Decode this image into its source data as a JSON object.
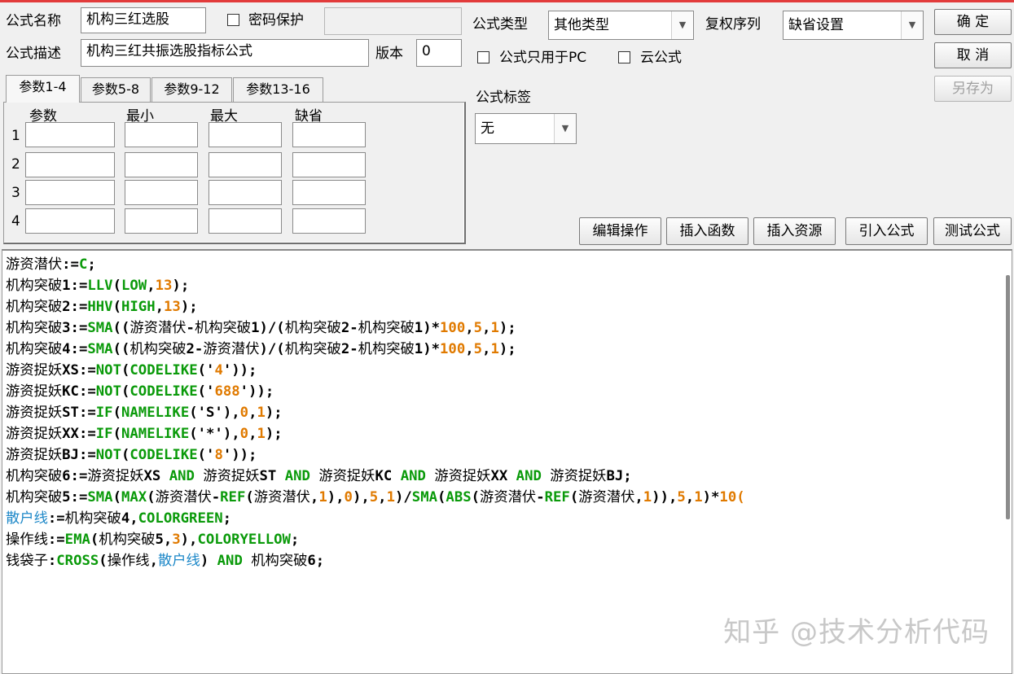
{
  "form": {
    "name_label": "公式名称",
    "name_value": "机构三红选股",
    "password_label": "密码保护",
    "password_value": "",
    "desc_label": "公式描述",
    "desc_value": "机构三红共振选股指标公式",
    "version_label": "版本",
    "version_value": "0",
    "type_label": "公式类型",
    "type_value": "其他类型",
    "rights_label": "复权序列",
    "rights_value": "缺省设置",
    "pc_only_label": "公式只用于PC",
    "cloud_label": "云公式",
    "tag_label": "公式标签",
    "tag_value": "无"
  },
  "buttons": {
    "ok": "确  定",
    "cancel": "取  消",
    "save_as": "另存为",
    "edit_ops": "编辑操作",
    "insert_func": "插入函数",
    "insert_res": "插入资源",
    "import_formula": "引入公式",
    "test_formula": "测试公式"
  },
  "tabs": [
    "参数1-4",
    "参数5-8",
    "参数9-12",
    "参数13-16"
  ],
  "params": {
    "headers": [
      "参数",
      "最小",
      "最大",
      "缺省"
    ],
    "rows": [
      "1",
      "2",
      "3",
      "4"
    ]
  },
  "code_lines": [
    [
      [
        "plain",
        "游资潜伏"
      ],
      [
        "op",
        ":="
      ],
      [
        "fn",
        "C"
      ],
      [
        "op",
        ";"
      ]
    ],
    [
      [
        "plain",
        "机构突破"
      ],
      [
        "op",
        "1:="
      ],
      [
        "fn",
        "LLV"
      ],
      [
        "op",
        "("
      ],
      [
        "fn",
        "LOW"
      ],
      [
        "op",
        ","
      ],
      [
        "num",
        "13"
      ],
      [
        "op",
        ");"
      ]
    ],
    [
      [
        "plain",
        "机构突破"
      ],
      [
        "op",
        "2:="
      ],
      [
        "fn",
        "HHV"
      ],
      [
        "op",
        "("
      ],
      [
        "fn",
        "HIGH"
      ],
      [
        "op",
        ","
      ],
      [
        "num",
        "13"
      ],
      [
        "op",
        ");"
      ]
    ],
    [
      [
        "plain",
        "机构突破"
      ],
      [
        "op",
        "3:="
      ],
      [
        "fn",
        "SMA"
      ],
      [
        "op",
        "(("
      ],
      [
        "plain",
        "游资潜伏"
      ],
      [
        "op",
        "-"
      ],
      [
        "plain",
        "机构突破"
      ],
      [
        "op",
        "1)/("
      ],
      [
        "plain",
        "机构突破"
      ],
      [
        "op",
        "2-"
      ],
      [
        "plain",
        "机构突破"
      ],
      [
        "op",
        "1)*"
      ],
      [
        "num",
        "100"
      ],
      [
        "op",
        ","
      ],
      [
        "num",
        "5"
      ],
      [
        "op",
        ","
      ],
      [
        "num",
        "1"
      ],
      [
        "op",
        ");"
      ]
    ],
    [
      [
        "plain",
        "机构突破"
      ],
      [
        "op",
        "4:="
      ],
      [
        "fn",
        "SMA"
      ],
      [
        "op",
        "(("
      ],
      [
        "plain",
        "机构突破"
      ],
      [
        "op",
        "2-"
      ],
      [
        "plain",
        "游资潜伏"
      ],
      [
        "op",
        ")/("
      ],
      [
        "plain",
        "机构突破"
      ],
      [
        "op",
        "2-"
      ],
      [
        "plain",
        "机构突破"
      ],
      [
        "op",
        "1)*"
      ],
      [
        "num",
        "100"
      ],
      [
        "op",
        ","
      ],
      [
        "num",
        "5"
      ],
      [
        "op",
        ","
      ],
      [
        "num",
        "1"
      ],
      [
        "op",
        ");"
      ]
    ],
    [
      [
        "plain",
        "游资捉妖"
      ],
      [
        "op",
        "XS:="
      ],
      [
        "fn",
        "NOT"
      ],
      [
        "op",
        "("
      ],
      [
        "fn",
        "CODELIKE"
      ],
      [
        "op",
        "('"
      ],
      [
        "str",
        "4"
      ],
      [
        "op",
        "'));"
      ]
    ],
    [
      [
        "plain",
        "游资捉妖"
      ],
      [
        "op",
        "KC:="
      ],
      [
        "fn",
        "NOT"
      ],
      [
        "op",
        "("
      ],
      [
        "fn",
        "CODELIKE"
      ],
      [
        "op",
        "('"
      ],
      [
        "str",
        "688"
      ],
      [
        "op",
        "'));"
      ]
    ],
    [
      [
        "plain",
        "游资捉妖"
      ],
      [
        "op",
        "ST:="
      ],
      [
        "fn",
        "IF"
      ],
      [
        "op",
        "("
      ],
      [
        "fn",
        "NAMELIKE"
      ],
      [
        "op",
        "('S'),"
      ],
      [
        "num",
        "0"
      ],
      [
        "op",
        ","
      ],
      [
        "num",
        "1"
      ],
      [
        "op",
        ");"
      ]
    ],
    [
      [
        "plain",
        "游资捉妖"
      ],
      [
        "op",
        "XX:="
      ],
      [
        "fn",
        "IF"
      ],
      [
        "op",
        "("
      ],
      [
        "fn",
        "NAMELIKE"
      ],
      [
        "op",
        "('*'),"
      ],
      [
        "num",
        "0"
      ],
      [
        "op",
        ","
      ],
      [
        "num",
        "1"
      ],
      [
        "op",
        ");"
      ]
    ],
    [
      [
        "plain",
        "游资捉妖"
      ],
      [
        "op",
        "BJ:="
      ],
      [
        "fn",
        "NOT"
      ],
      [
        "op",
        "("
      ],
      [
        "fn",
        "CODELIKE"
      ],
      [
        "op",
        "('"
      ],
      [
        "str",
        "8"
      ],
      [
        "op",
        "'));"
      ]
    ],
    [
      [
        "plain",
        "机构突破"
      ],
      [
        "op",
        "6:="
      ],
      [
        "plain",
        "游资捉妖"
      ],
      [
        "op",
        "XS "
      ],
      [
        "kw",
        "AND"
      ],
      [
        "op",
        " "
      ],
      [
        "plain",
        "游资捉妖"
      ],
      [
        "op",
        "ST "
      ],
      [
        "kw",
        "AND"
      ],
      [
        "op",
        " "
      ],
      [
        "plain",
        "游资捉妖"
      ],
      [
        "op",
        "KC "
      ],
      [
        "kw",
        "AND"
      ],
      [
        "op",
        " "
      ],
      [
        "plain",
        "游资捉妖"
      ],
      [
        "op",
        "XX "
      ],
      [
        "kw",
        "AND"
      ],
      [
        "op",
        " "
      ],
      [
        "plain",
        "游资捉妖"
      ],
      [
        "op",
        "BJ;"
      ]
    ],
    [
      [
        "plain",
        "机构突破"
      ],
      [
        "op",
        "5:="
      ],
      [
        "fn",
        "SMA"
      ],
      [
        "op",
        "("
      ],
      [
        "fn",
        "MAX"
      ],
      [
        "op",
        "("
      ],
      [
        "plain",
        "游资潜伏"
      ],
      [
        "op",
        "-"
      ],
      [
        "fn",
        "REF"
      ],
      [
        "op",
        "("
      ],
      [
        "plain",
        "游资潜伏"
      ],
      [
        "op",
        ","
      ],
      [
        "num",
        "1"
      ],
      [
        "op",
        "),"
      ],
      [
        "num",
        "0"
      ],
      [
        "op",
        "),"
      ],
      [
        "num",
        "5"
      ],
      [
        "op",
        ","
      ],
      [
        "num",
        "1"
      ],
      [
        "op",
        ")/"
      ],
      [
        "fn",
        "SMA"
      ],
      [
        "op",
        "("
      ],
      [
        "fn",
        "ABS"
      ],
      [
        "op",
        "("
      ],
      [
        "plain",
        "游资潜伏"
      ],
      [
        "op",
        "-"
      ],
      [
        "fn",
        "REF"
      ],
      [
        "op",
        "("
      ],
      [
        "plain",
        "游资潜伏"
      ],
      [
        "op",
        ","
      ],
      [
        "num",
        "1"
      ],
      [
        "op",
        ")),"
      ],
      [
        "num",
        "5"
      ],
      [
        "op",
        ","
      ],
      [
        "num",
        "1"
      ],
      [
        "op",
        ")*"
      ],
      [
        "num",
        "10("
      ]
    ],
    [
      [
        "var",
        "散户线"
      ],
      [
        "op",
        ":="
      ],
      [
        "plain",
        "机构突破"
      ],
      [
        "op",
        "4,"
      ],
      [
        "fn",
        "COLORGREEN"
      ],
      [
        "op",
        ";"
      ]
    ],
    [
      [
        "plain",
        "操作线"
      ],
      [
        "op",
        ":="
      ],
      [
        "fn",
        "EMA"
      ],
      [
        "op",
        "("
      ],
      [
        "plain",
        "机构突破"
      ],
      [
        "op",
        "5,"
      ],
      [
        "num",
        "3"
      ],
      [
        "op",
        "),"
      ],
      [
        "fn",
        "COLORYELLOW"
      ],
      [
        "op",
        ";"
      ]
    ],
    [
      [
        "plain",
        "钱袋子"
      ],
      [
        "op",
        ":"
      ],
      [
        "fn",
        "CROSS"
      ],
      [
        "op",
        "("
      ],
      [
        "plain",
        "操作线"
      ],
      [
        "op",
        ","
      ],
      [
        "var",
        "散户线"
      ],
      [
        "op",
        ") "
      ],
      [
        "kw",
        "AND"
      ],
      [
        "op",
        " "
      ],
      [
        "plain",
        "机构突破"
      ],
      [
        "op",
        "6;"
      ]
    ]
  ],
  "watermark": "知乎 @技术分析代码"
}
